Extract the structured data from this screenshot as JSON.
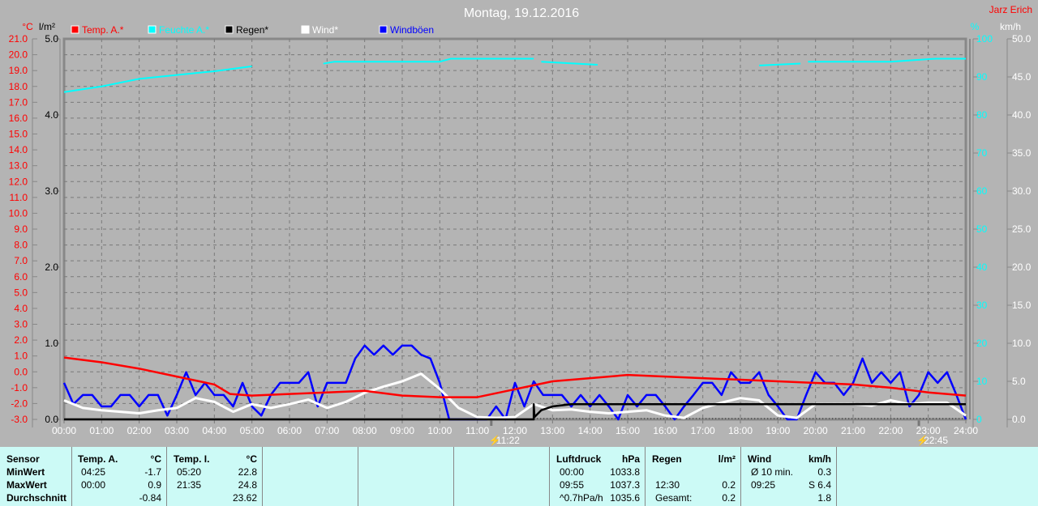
{
  "title": "Montag, 19.12.2016",
  "author": "Jarz Erich",
  "colors": {
    "temp": "#ff0000",
    "humidity": "#00ffff",
    "rain": "#000000",
    "wind": "#ffffff",
    "gusts": "#0000ff"
  },
  "chart_data": {
    "type": "line",
    "title": "Montag, 19.12.2016",
    "x_ticks": [
      "00:00",
      "01:00",
      "02:00",
      "03:00",
      "04:00",
      "05:00",
      "06:00",
      "07:00",
      "08:00",
      "09:00",
      "10:00",
      "11:00",
      "12:00",
      "13:00",
      "14:00",
      "15:00",
      "16:00",
      "17:00",
      "18:00",
      "19:00",
      "20:00",
      "21:00",
      "22:00",
      "23:00",
      "24:00"
    ],
    "axes": {
      "temp": {
        "unit": "°C",
        "range": [
          -3,
          21
        ],
        "ticks": [
          "21.0",
          "20.0",
          "19.0",
          "18.0",
          "17.0",
          "16.0",
          "15.0",
          "14.0",
          "13.0",
          "12.0",
          "11.0",
          "10.0",
          "9.0",
          "8.0",
          "7.0",
          "6.0",
          "5.0",
          "4.0",
          "3.0",
          "2.0",
          "1.0",
          "0.0",
          "-1.0",
          "-2.0",
          "-3.0"
        ]
      },
      "rain": {
        "unit": "l/m²",
        "range": [
          0,
          5
        ],
        "ticks": [
          "5.0",
          "4.0",
          "3.0",
          "2.0",
          "1.0",
          "0.0"
        ]
      },
      "humidity": {
        "unit": "%",
        "range": [
          0,
          100
        ],
        "ticks": [
          "100",
          "90",
          "80",
          "70",
          "60",
          "50",
          "40",
          "30",
          "20",
          "10",
          "0"
        ]
      },
      "wind": {
        "unit": "km/h",
        "range": [
          0,
          50
        ],
        "ticks": [
          "50.0",
          "45.0",
          "40.0",
          "35.0",
          "30.0",
          "25.0",
          "20.0",
          "15.0",
          "10.0",
          "5.0",
          "0.0"
        ]
      }
    },
    "legend": [
      "Temp. A.*",
      "Feuchte A.*",
      "Regen*",
      "Wind*",
      "Windböen"
    ],
    "legend_placement": "top",
    "grid": true,
    "series": {
      "temp": {
        "name": "Temp. A.*",
        "x_hours": [
          0,
          1,
          2,
          3,
          4,
          4.42,
          5,
          6,
          7,
          8,
          9,
          10,
          11,
          12,
          13,
          14,
          15,
          16,
          17,
          18,
          19,
          20,
          21,
          22,
          23,
          24
        ],
        "values": [
          0.9,
          0.6,
          0.2,
          -0.3,
          -0.8,
          -1.4,
          -1.5,
          -1.4,
          -1.3,
          -1.2,
          -1.5,
          -1.6,
          -1.6,
          -1.1,
          -0.6,
          -0.4,
          -0.2,
          -0.3,
          -0.4,
          -0.5,
          -0.6,
          -0.7,
          -0.8,
          -1.0,
          -1.3,
          -1.5
        ]
      },
      "humidity": {
        "name": "Feuchte A.*",
        "segments": [
          [
            [
              0,
              86
            ],
            [
              1,
              87.5
            ],
            [
              2,
              89.5
            ],
            [
              3,
              90.5
            ],
            [
              4,
              91.5
            ],
            [
              5,
              92.8
            ]
          ],
          [
            [
              6.9,
              93.5
            ],
            [
              7.2,
              94
            ],
            [
              10,
              94
            ],
            [
              10.3,
              94.8
            ],
            [
              12.5,
              94.8
            ]
          ],
          [
            [
              12.7,
              94
            ],
            [
              14.2,
              93.2
            ]
          ],
          [
            [
              18.5,
              93
            ],
            [
              19.6,
              93.5
            ]
          ],
          [
            [
              19.8,
              94
            ],
            [
              22,
              94
            ],
            [
              23.2,
              94.8
            ],
            [
              24,
              94.8
            ]
          ]
        ]
      },
      "rain": {
        "name": "Regen*",
        "x_hours": [
          0,
          12.5,
          12.5,
          12.52,
          12.7,
          13,
          13.5,
          24
        ],
        "values": [
          0,
          0,
          0.2,
          0.03,
          0.12,
          0.17,
          0.2,
          0.2
        ]
      },
      "wind": {
        "name": "Wind*",
        "step_hours": 0.5,
        "values": [
          2.5,
          1.5,
          1.2,
          1.0,
          0.8,
          1.2,
          1.5,
          2.8,
          2.3,
          1.0,
          2.0,
          1.5,
          2.0,
          2.6,
          1.5,
          2.3,
          3.5,
          4.3,
          5.0,
          6.0,
          4.0,
          1.5,
          0.3,
          0.2,
          0.3,
          2.0,
          1.2,
          1.3,
          1.0,
          0.8,
          1.0,
          1.2,
          0.5,
          0.2,
          1.5,
          2.2,
          2.8,
          2.5,
          0.5,
          0.2,
          2.0,
          2.0,
          2.0,
          1.8,
          2.5,
          2.0,
          2.2,
          2.2,
          0.5
        ]
      },
      "gusts": {
        "name": "Windböen",
        "step_hours": 0.25,
        "values": [
          4.8,
          2.0,
          3.2,
          3.2,
          1.7,
          1.7,
          3.2,
          3.2,
          1.7,
          3.2,
          3.2,
          0.5,
          3.2,
          6.2,
          3.2,
          4.8,
          3.2,
          3.2,
          1.7,
          4.8,
          1.7,
          0.5,
          3.2,
          4.8,
          4.8,
          4.8,
          6.2,
          1.7,
          4.8,
          4.8,
          4.8,
          8.0,
          9.7,
          8.5,
          9.7,
          8.5,
          9.7,
          9.7,
          8.5,
          8.0,
          4.8,
          0,
          0,
          0,
          0,
          0,
          1.7,
          0,
          4.8,
          1.7,
          5.0,
          3.2,
          3.2,
          3.2,
          1.7,
          3.2,
          1.7,
          3.2,
          1.7,
          0,
          3.2,
          1.7,
          3.2,
          3.2,
          1.7,
          0,
          1.7,
          3.2,
          4.8,
          4.8,
          3.2,
          6.2,
          4.8,
          4.8,
          6.2,
          3.2,
          1.7,
          0,
          0,
          3.2,
          6.2,
          4.8,
          4.8,
          3.2,
          4.8,
          8.0,
          4.8,
          6.2,
          4.8,
          6.2,
          1.7,
          3.2,
          6.2,
          4.8,
          6.2,
          3.2,
          0
        ]
      }
    },
    "events": [
      {
        "hour": 11.37,
        "label": "11:22",
        "icon": "lightning-icon"
      },
      {
        "hour": 22.75,
        "label": "22:45",
        "icon": "lightning-icon"
      }
    ]
  },
  "table": {
    "sensor": {
      "header": "Sensor",
      "rows": [
        "MinWert",
        "MaxWert",
        "Durchschnitt"
      ]
    },
    "temp_a": {
      "header": "Temp. A.",
      "unit": "°C",
      "times": [
        "04:25",
        "00:00",
        ""
      ],
      "values": [
        "-1.7",
        "0.9",
        "-0.84"
      ]
    },
    "temp_i": {
      "header": "Temp. I.",
      "unit": "°C",
      "times": [
        "05:20",
        "21:35",
        ""
      ],
      "values": [
        "22.8",
        "24.8",
        "23.62"
      ]
    },
    "pressure": {
      "header": "Luftdruck",
      "unit": "hPa",
      "times": [
        "00:00",
        "09:55",
        "^0.7hPa/h"
      ],
      "values": [
        "1033.8",
        "1037.3",
        "1035.6"
      ]
    },
    "rain": {
      "header": "Regen",
      "unit": "l/m²",
      "times": [
        "",
        "12:30",
        "Gesamt:"
      ],
      "values": [
        "",
        "0.2",
        "0.2"
      ]
    },
    "wind": {
      "header": "Wind",
      "unit": "km/h",
      "times": [
        "Ø 10 min.",
        "09:25",
        ""
      ],
      "values": [
        "0.3",
        "S 6.4",
        "1.8"
      ]
    }
  }
}
